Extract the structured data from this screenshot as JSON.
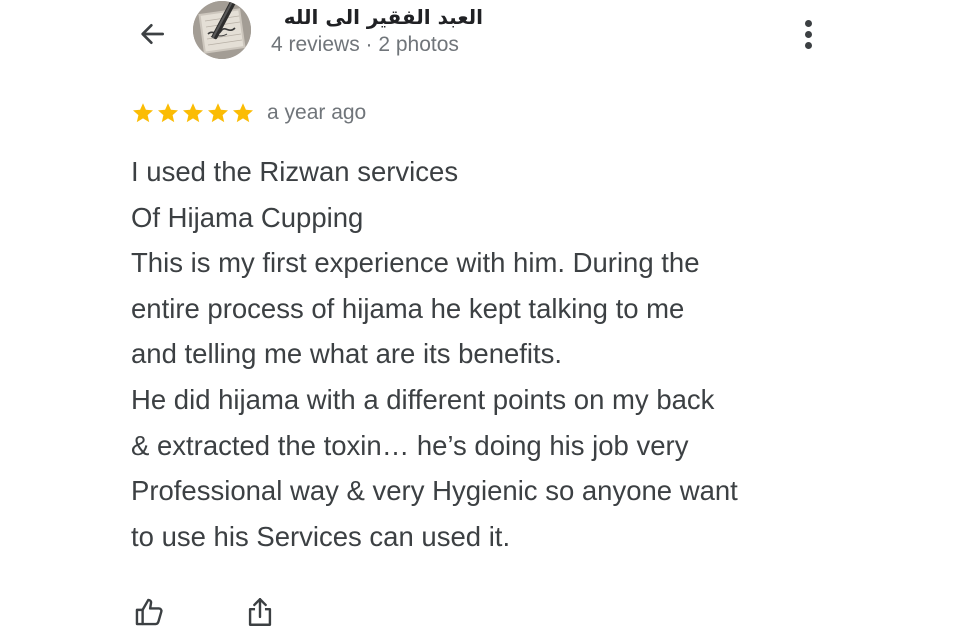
{
  "header": {
    "back_icon": "arrow-left-icon",
    "reviewer_name": "العبد الفقير الى الله",
    "reviewer_meta": "4 reviews · 2 photos",
    "more_icon": "more-vertical-icon"
  },
  "review": {
    "rating": 5,
    "rating_max": 5,
    "star_color": "#fbbc04",
    "date": "a year ago",
    "lines": [
      "I used the Rizwan services",
      "Of Hijama Cupping",
      "This is my first experience with him. During the",
      "entire process of hijama he kept talking to me",
      "and telling me what are its benefits.",
      "He did hijama with a different points on my back",
      "& extracted the toxin… he’s doing his job very",
      "Professional way & very Hygienic so anyone want",
      "to use his Services can used it."
    ]
  },
  "actions": {
    "like_icon": "thumbs-up-icon",
    "share_icon": "share-icon"
  }
}
